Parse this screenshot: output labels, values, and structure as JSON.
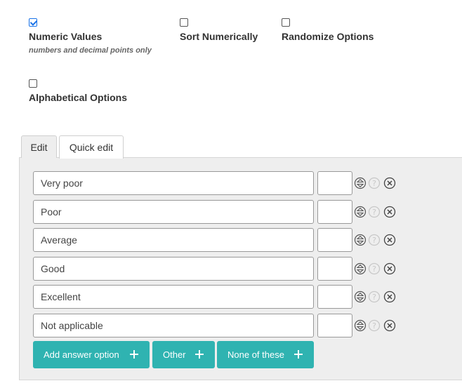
{
  "options": {
    "numeric_values": {
      "label": "Numeric Values",
      "hint": "numbers and decimal points only",
      "checked": true
    },
    "sort_numerically": {
      "label": "Sort Numerically",
      "checked": false
    },
    "randomize_options": {
      "label": "Randomize Options",
      "checked": false
    },
    "alphabetical_options": {
      "label": "Alphabetical Options",
      "checked": false
    }
  },
  "tabs": [
    {
      "label": "Edit",
      "active": true
    },
    {
      "label": "Quick edit",
      "active": false
    }
  ],
  "answers": [
    {
      "text": "Very poor",
      "code": ""
    },
    {
      "text": "Poor",
      "code": ""
    },
    {
      "text": "Average",
      "code": ""
    },
    {
      "text": "Good",
      "code": ""
    },
    {
      "text": "Excellent",
      "code": ""
    },
    {
      "text": "Not applicable",
      "code": ""
    }
  ],
  "row_icons": [
    "sort-arrows-icon",
    "help-icon",
    "remove-circle-icon"
  ],
  "buttons": {
    "add_answer": "Add answer option",
    "other": "Other",
    "none_of_these": "None of these"
  },
  "colors": {
    "accent": "#2fb3b1",
    "panel": "#eeeeee",
    "checkbox": "#1a73e8"
  }
}
